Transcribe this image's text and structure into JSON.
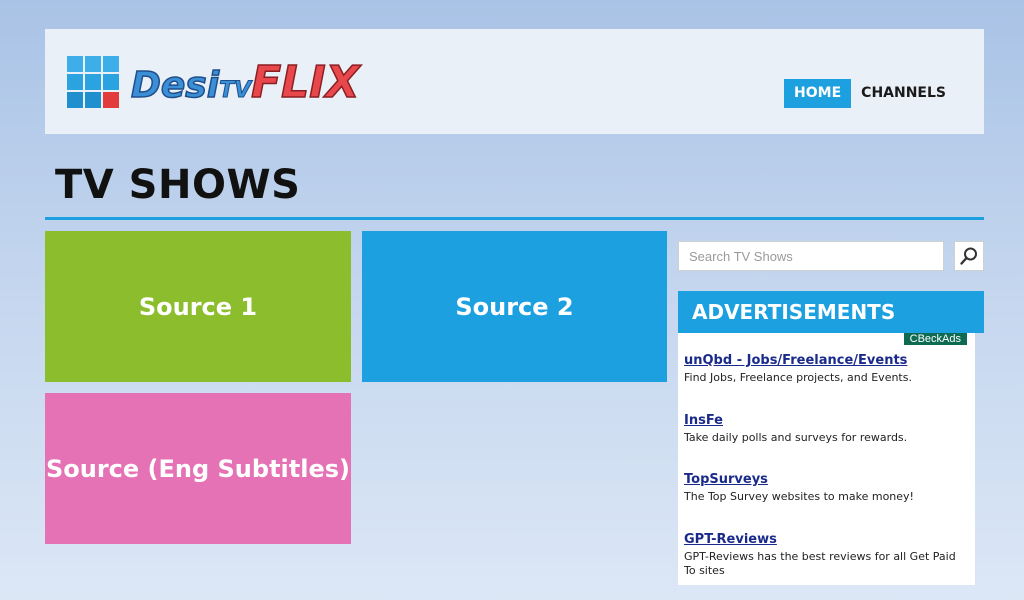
{
  "header": {
    "brand": {
      "desi": "Desi",
      "tv": "TV",
      "flix": "FLIX"
    },
    "nav": [
      {
        "label": "HOME",
        "active": true
      },
      {
        "label": "CHANNELS",
        "active": false
      }
    ]
  },
  "page_title": "TV SHOWS",
  "tiles": [
    {
      "label": "Source 1",
      "color": "#8cbd2c"
    },
    {
      "label": "Source 2",
      "color": "#1da0e0"
    },
    {
      "label": "Source (Eng Subtitles)",
      "color": "#e572b4"
    }
  ],
  "search": {
    "placeholder": "Search TV Shows",
    "value": "",
    "icon": "search-icon"
  },
  "ads": {
    "heading": "ADVERTISEMENTS",
    "provider": "CBeckAds",
    "items": [
      {
        "title": "unQbd - Jobs/Freelance/Events",
        "desc": "Find Jobs, Freelance projects, and Events."
      },
      {
        "title": "InsFe",
        "desc": "Take daily polls and surveys for rewards."
      },
      {
        "title": "TopSurveys",
        "desc": "The Top Survey websites to make money!"
      },
      {
        "title": "GPT-Reviews",
        "desc": "GPT-Reviews has the best reviews for all Get Paid To sites"
      }
    ]
  },
  "colors": {
    "accent": "#1da0e0",
    "green": "#8cbd2c",
    "pink": "#e572b4"
  }
}
